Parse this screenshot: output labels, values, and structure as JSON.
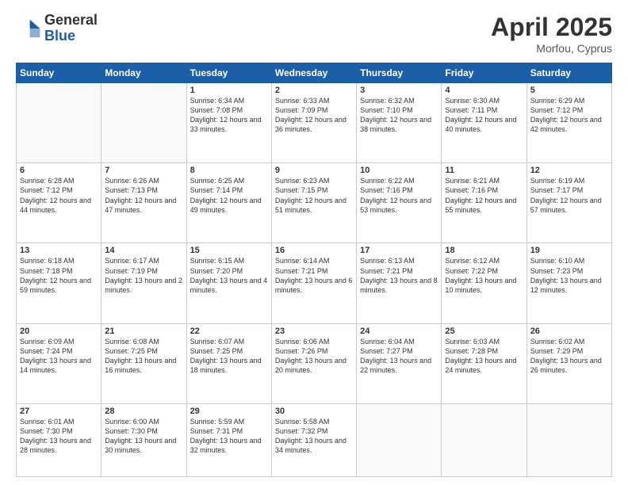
{
  "header": {
    "logo_general": "General",
    "logo_blue": "Blue",
    "title": "April 2025",
    "location": "Morfou, Cyprus"
  },
  "days_of_week": [
    "Sunday",
    "Monday",
    "Tuesday",
    "Wednesday",
    "Thursday",
    "Friday",
    "Saturday"
  ],
  "weeks": [
    [
      {
        "day": "",
        "info": ""
      },
      {
        "day": "",
        "info": ""
      },
      {
        "day": "1",
        "info": "Sunrise: 6:34 AM\nSunset: 7:08 PM\nDaylight: 12 hours and 33 minutes."
      },
      {
        "day": "2",
        "info": "Sunrise: 6:33 AM\nSunset: 7:09 PM\nDaylight: 12 hours and 36 minutes."
      },
      {
        "day": "3",
        "info": "Sunrise: 6:32 AM\nSunset: 7:10 PM\nDaylight: 12 hours and 38 minutes."
      },
      {
        "day": "4",
        "info": "Sunrise: 6:30 AM\nSunset: 7:11 PM\nDaylight: 12 hours and 40 minutes."
      },
      {
        "day": "5",
        "info": "Sunrise: 6:29 AM\nSunset: 7:12 PM\nDaylight: 12 hours and 42 minutes."
      }
    ],
    [
      {
        "day": "6",
        "info": "Sunrise: 6:28 AM\nSunset: 7:12 PM\nDaylight: 12 hours and 44 minutes."
      },
      {
        "day": "7",
        "info": "Sunrise: 6:26 AM\nSunset: 7:13 PM\nDaylight: 12 hours and 47 minutes."
      },
      {
        "day": "8",
        "info": "Sunrise: 6:25 AM\nSunset: 7:14 PM\nDaylight: 12 hours and 49 minutes."
      },
      {
        "day": "9",
        "info": "Sunrise: 6:23 AM\nSunset: 7:15 PM\nDaylight: 12 hours and 51 minutes."
      },
      {
        "day": "10",
        "info": "Sunrise: 6:22 AM\nSunset: 7:16 PM\nDaylight: 12 hours and 53 minutes."
      },
      {
        "day": "11",
        "info": "Sunrise: 6:21 AM\nSunset: 7:16 PM\nDaylight: 12 hours and 55 minutes."
      },
      {
        "day": "12",
        "info": "Sunrise: 6:19 AM\nSunset: 7:17 PM\nDaylight: 12 hours and 57 minutes."
      }
    ],
    [
      {
        "day": "13",
        "info": "Sunrise: 6:18 AM\nSunset: 7:18 PM\nDaylight: 12 hours and 59 minutes."
      },
      {
        "day": "14",
        "info": "Sunrise: 6:17 AM\nSunset: 7:19 PM\nDaylight: 13 hours and 2 minutes."
      },
      {
        "day": "15",
        "info": "Sunrise: 6:15 AM\nSunset: 7:20 PM\nDaylight: 13 hours and 4 minutes."
      },
      {
        "day": "16",
        "info": "Sunrise: 6:14 AM\nSunset: 7:21 PM\nDaylight: 13 hours and 6 minutes."
      },
      {
        "day": "17",
        "info": "Sunrise: 6:13 AM\nSunset: 7:21 PM\nDaylight: 13 hours and 8 minutes."
      },
      {
        "day": "18",
        "info": "Sunrise: 6:12 AM\nSunset: 7:22 PM\nDaylight: 13 hours and 10 minutes."
      },
      {
        "day": "19",
        "info": "Sunrise: 6:10 AM\nSunset: 7:23 PM\nDaylight: 13 hours and 12 minutes."
      }
    ],
    [
      {
        "day": "20",
        "info": "Sunrise: 6:09 AM\nSunset: 7:24 PM\nDaylight: 13 hours and 14 minutes."
      },
      {
        "day": "21",
        "info": "Sunrise: 6:08 AM\nSunset: 7:25 PM\nDaylight: 13 hours and 16 minutes."
      },
      {
        "day": "22",
        "info": "Sunrise: 6:07 AM\nSunset: 7:25 PM\nDaylight: 13 hours and 18 minutes."
      },
      {
        "day": "23",
        "info": "Sunrise: 6:06 AM\nSunset: 7:26 PM\nDaylight: 13 hours and 20 minutes."
      },
      {
        "day": "24",
        "info": "Sunrise: 6:04 AM\nSunset: 7:27 PM\nDaylight: 13 hours and 22 minutes."
      },
      {
        "day": "25",
        "info": "Sunrise: 6:03 AM\nSunset: 7:28 PM\nDaylight: 13 hours and 24 minutes."
      },
      {
        "day": "26",
        "info": "Sunrise: 6:02 AM\nSunset: 7:29 PM\nDaylight: 13 hours and 26 minutes."
      }
    ],
    [
      {
        "day": "27",
        "info": "Sunrise: 6:01 AM\nSunset: 7:30 PM\nDaylight: 13 hours and 28 minutes."
      },
      {
        "day": "28",
        "info": "Sunrise: 6:00 AM\nSunset: 7:30 PM\nDaylight: 13 hours and 30 minutes."
      },
      {
        "day": "29",
        "info": "Sunrise: 5:59 AM\nSunset: 7:31 PM\nDaylight: 13 hours and 32 minutes."
      },
      {
        "day": "30",
        "info": "Sunrise: 5:58 AM\nSunset: 7:32 PM\nDaylight: 13 hours and 34 minutes."
      },
      {
        "day": "",
        "info": ""
      },
      {
        "day": "",
        "info": ""
      },
      {
        "day": "",
        "info": ""
      }
    ]
  ]
}
